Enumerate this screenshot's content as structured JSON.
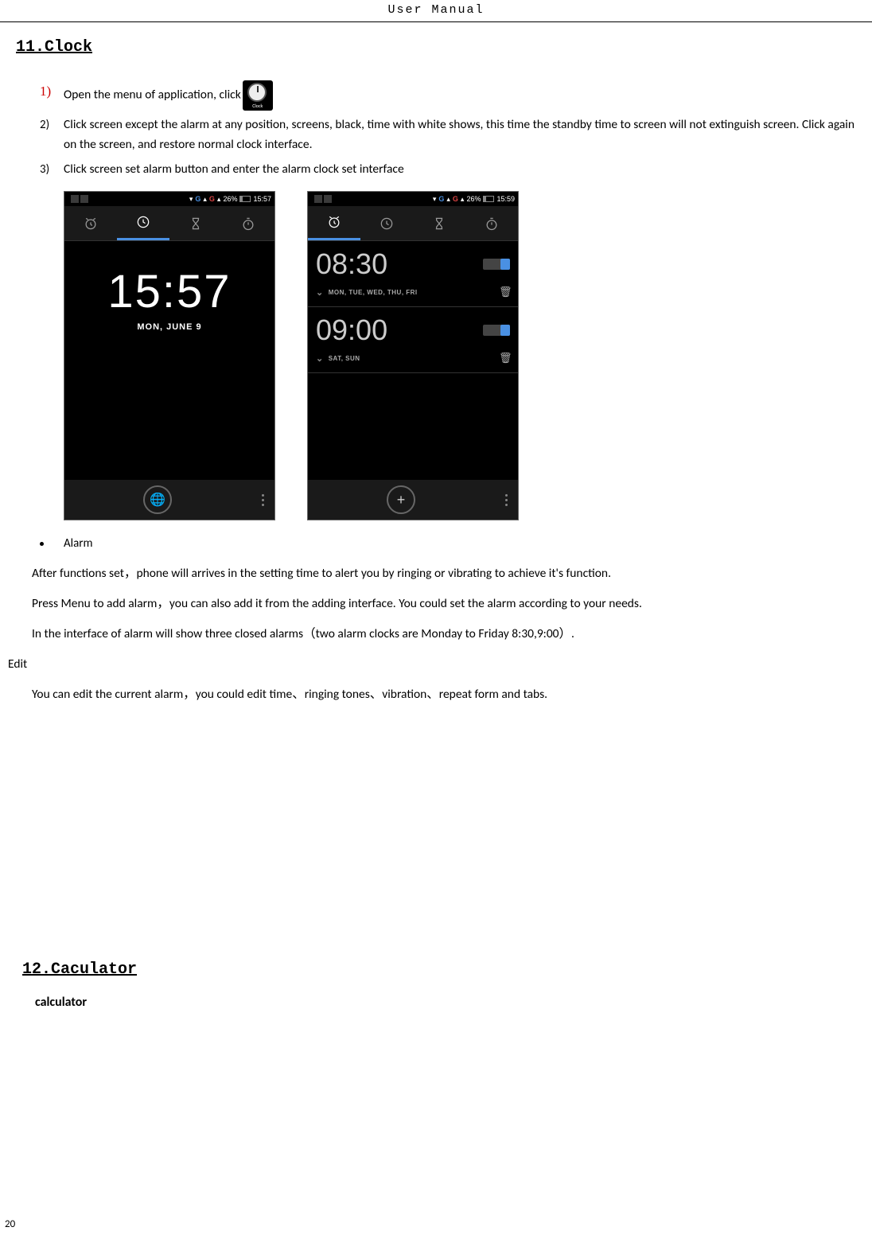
{
  "header": "User   Manual",
  "section1_title": "11.Clock",
  "step1_num": "1)",
  "step1_text": "Open the menu of application, click",
  "clock_icon_label": "Clock",
  "step2_num": "2)",
  "step2_text": "Click screen except the alarm at any position, screens, black, time with white shows, this time the standby time to screen will not extinguish screen. Click again on the screen, and restore normal clock interface.",
  "step3_num": "3)",
  "step3_text": "Click screen set alarm button and enter the alarm clock set interface",
  "phone1": {
    "status": {
      "battery_pct": "26%",
      "time": "15:57",
      "g1": "G",
      "g2": "G"
    },
    "clock_time": "15:57",
    "clock_date": "MON, JUNE 9"
  },
  "phone2": {
    "status": {
      "battery_pct": "26%",
      "time": "15:59",
      "g1": "G",
      "g2": "G"
    },
    "alarm1": {
      "time": "08:30",
      "days": "MON, TUE, WED, THU, FRI"
    },
    "alarm2": {
      "time": "09:00",
      "days": "SAT, SUN"
    }
  },
  "bullet_alarm": "Alarm",
  "para1": "After functions set，phone will arrives in the setting time to alert you by ringing or vibrating to achieve it's function.",
  "para2": "Press Menu to add alarm，you can also add it from the adding interface. You could set the alarm according to your needs.",
  "para3": "In the interface of alarm will show three closed alarms（two alarm clocks are Monday to Friday 8:30,9:00）.",
  "edit_label": "Edit",
  "para4": "You can edit the current alarm，you could edit time、ringing tones、vibration、repeat form and tabs.",
  "section2_title": "12.Caculator",
  "calculator_sub": "calculator",
  "page_num": "20"
}
